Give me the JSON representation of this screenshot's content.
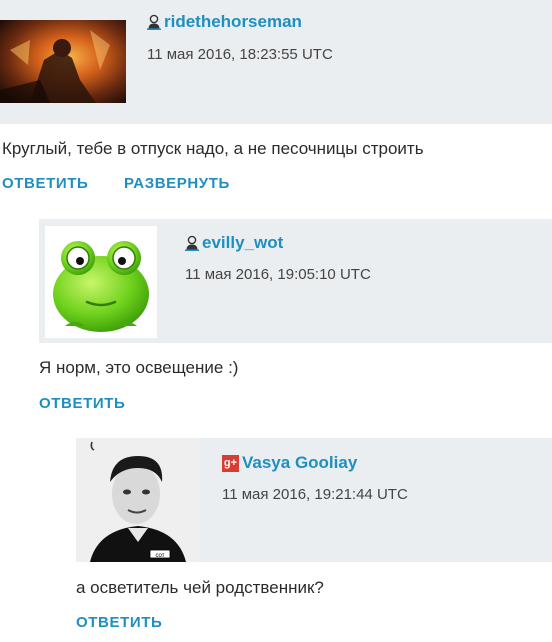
{
  "comments": [
    {
      "username": "ridethehorseman",
      "date": "11 мая 2016, 18:23:55 UTC",
      "text": "Круглый, тебе в отпуск надо, а не песочницы строить",
      "actions": [
        "ОТВЕТИТЬ",
        "РАЗВЕРНУТЬ"
      ],
      "avatar_icon": "horseman-avatar",
      "user_icon": "user-icon"
    },
    {
      "username": "evilly_wot",
      "date": "11 мая 2016, 19:05:10 UTC",
      "text": "Я норм, это освещение :)",
      "actions": [
        "ОТВЕТИТЬ"
      ],
      "avatar_icon": "green-frog-avatar",
      "user_icon": "user-icon"
    },
    {
      "username": "Vasya Gooliay",
      "date": "11 мая 2016, 19:21:44 UTC",
      "text": "а осветитель чей родственник?",
      "actions": [
        "ОТВЕТИТЬ"
      ],
      "avatar_icon": "man-portrait-avatar",
      "user_icon": "google-plus-icon",
      "gplus_glyph": "g+"
    }
  ],
  "colors": {
    "accent": "#1e8fc0",
    "header_bg": "#ebeef0",
    "gplus": "#d73d32"
  }
}
